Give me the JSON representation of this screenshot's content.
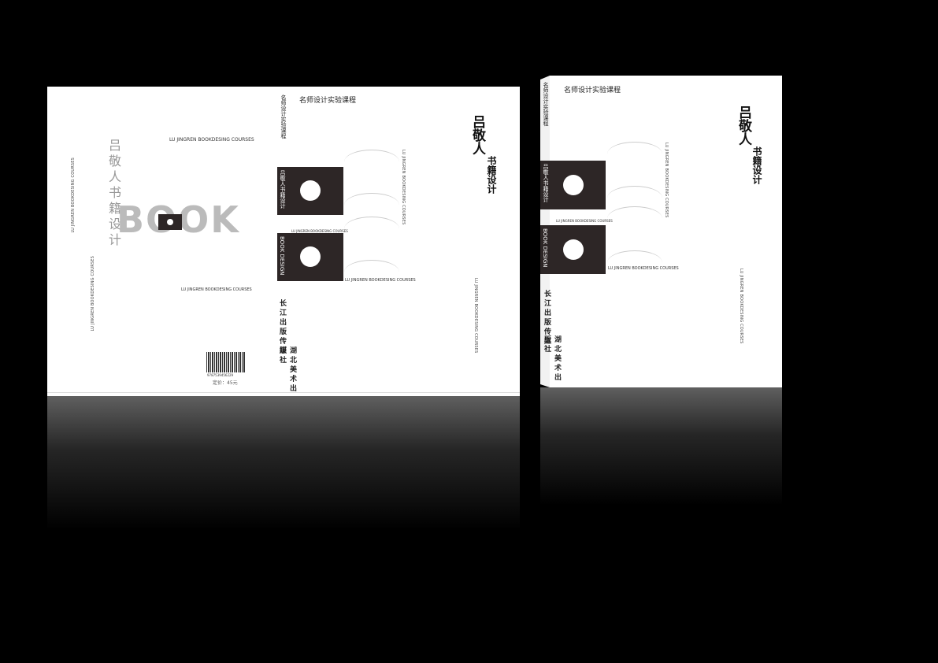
{
  "series_label": "名师设计实验课程",
  "author_title": "吕敬人",
  "subtitle": "书籍设计",
  "spine_title": "吕敬人书籍设计",
  "book_design": "BOOK DESIGN",
  "courses_en": "LU JINGREN BOOKDESING COURSES",
  "big_word": "BOOK",
  "calligraphy_title": "吕敬人书籍设计",
  "publisher_1": "长江出版传媒",
  "publisher_2": "湖北美术出版社",
  "isbn_digits": "9787539456229",
  "price": "定价：45元"
}
